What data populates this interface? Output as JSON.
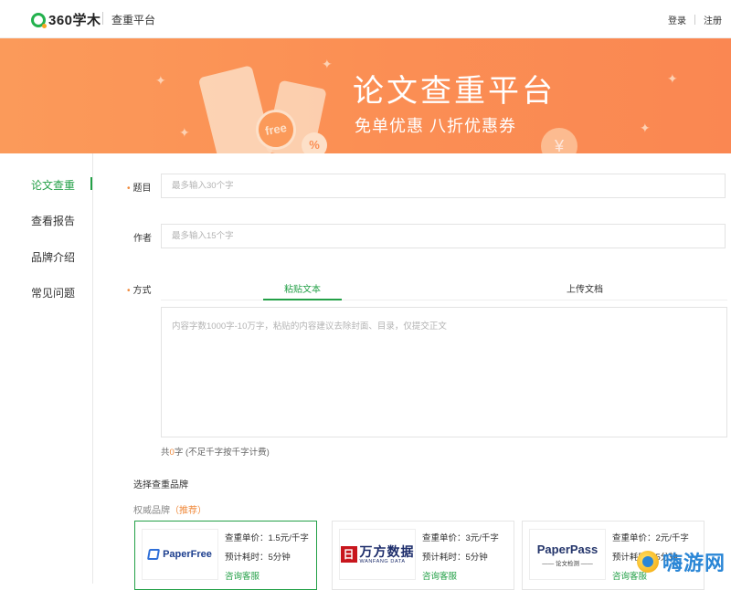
{
  "header": {
    "logo_text": "360学木",
    "platform": "查重平台",
    "login": "登录",
    "register": "注册"
  },
  "banner": {
    "title": "论文查重平台",
    "subtitle": "免单优惠   八折优惠券",
    "badge_free": "free",
    "badge_pct": "%",
    "badge_yen": "¥"
  },
  "sidebar": {
    "items": [
      {
        "label": "论文查重",
        "active": true
      },
      {
        "label": "查看报告"
      },
      {
        "label": "品牌介绍"
      },
      {
        "label": "常见问题"
      }
    ]
  },
  "form": {
    "title_label": "题目",
    "title_placeholder": "最多输入30个字",
    "author_label": "作者",
    "author_placeholder": "最多输入15个字",
    "method_label": "方式",
    "tabs": [
      {
        "label": "粘贴文本",
        "active": true
      },
      {
        "label": "上传文档"
      }
    ],
    "content_placeholder": "内容字数1000字-10万字，粘贴的内容建议去除封面、目录，仅提交正文",
    "count_prefix": "共",
    "count_value": "0",
    "count_suffix": "字 (不足千字按千字计费)"
  },
  "brands": {
    "section_title": "选择查重品牌",
    "category": "权威品牌",
    "recommend": "（推荐）",
    "cards": [
      {
        "logo": "PaperFree",
        "price": "查重单价：1.5元/千字",
        "time": "预计耗时：5分钟",
        "consult": "咨询客服",
        "selected": true
      },
      {
        "logo_cn": "万方数据",
        "logo_en": "WANFANG DATA",
        "logo_icon": "日",
        "price": "查重单价：3元/千字",
        "time": "预计耗时：5分钟",
        "consult": "咨询客服"
      },
      {
        "logo": "PaperPass",
        "logo_sub": "—— 论文检测 ——",
        "price": "查重单价：2元/千字",
        "time": "预计耗时：5分钟",
        "consult": "咨询客服"
      }
    ]
  },
  "watermark": {
    "text": "嗨游网"
  },
  "colors": {
    "accent": "#23a047",
    "banner": "#fb8f54",
    "highlight": "#f08a3c"
  }
}
